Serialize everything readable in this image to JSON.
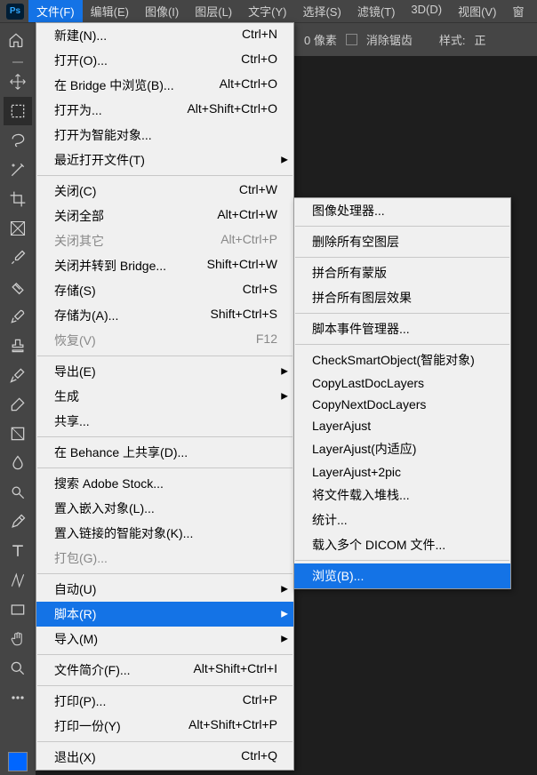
{
  "menubar": [
    "文件(F)",
    "编辑(E)",
    "图像(I)",
    "图层(L)",
    "文字(Y)",
    "选择(S)",
    "滤镜(T)",
    "3D(D)",
    "视图(V)",
    "窗"
  ],
  "psLabel": "Ps",
  "options": {
    "pixelValue": "0",
    "pixelUnit": "像素",
    "antialias": "消除锯齿",
    "style": "样式:",
    "styleVal": "正"
  },
  "file": [
    {
      "type": "item",
      "label": "新建(N)...",
      "short": "Ctrl+N"
    },
    {
      "type": "item",
      "label": "打开(O)...",
      "short": "Ctrl+O"
    },
    {
      "type": "item",
      "label": "在 Bridge 中浏览(B)...",
      "short": "Alt+Ctrl+O"
    },
    {
      "type": "item",
      "label": "打开为...",
      "short": "Alt+Shift+Ctrl+O"
    },
    {
      "type": "item",
      "label": "打开为智能对象..."
    },
    {
      "type": "item",
      "label": "最近打开文件(T)",
      "sub": true
    },
    {
      "type": "sep"
    },
    {
      "type": "item",
      "label": "关闭(C)",
      "short": "Ctrl+W"
    },
    {
      "type": "item",
      "label": "关闭全部",
      "short": "Alt+Ctrl+W"
    },
    {
      "type": "item",
      "label": "关闭其它",
      "short": "Alt+Ctrl+P",
      "disabled": true
    },
    {
      "type": "item",
      "label": "关闭并转到 Bridge...",
      "short": "Shift+Ctrl+W"
    },
    {
      "type": "item",
      "label": "存储(S)",
      "short": "Ctrl+S"
    },
    {
      "type": "item",
      "label": "存储为(A)...",
      "short": "Shift+Ctrl+S"
    },
    {
      "type": "item",
      "label": "恢复(V)",
      "short": "F12",
      "disabled": true
    },
    {
      "type": "sep"
    },
    {
      "type": "item",
      "label": "导出(E)",
      "sub": true
    },
    {
      "type": "item",
      "label": "生成",
      "sub": true
    },
    {
      "type": "item",
      "label": "共享..."
    },
    {
      "type": "sep"
    },
    {
      "type": "item",
      "label": "在 Behance 上共享(D)..."
    },
    {
      "type": "sep"
    },
    {
      "type": "item",
      "label": "搜索 Adobe Stock..."
    },
    {
      "type": "item",
      "label": "置入嵌入对象(L)..."
    },
    {
      "type": "item",
      "label": "置入链接的智能对象(K)..."
    },
    {
      "type": "item",
      "label": "打包(G)...",
      "disabled": true
    },
    {
      "type": "sep"
    },
    {
      "type": "item",
      "label": "自动(U)",
      "sub": true
    },
    {
      "type": "item",
      "label": "脚本(R)",
      "sub": true,
      "hl": true
    },
    {
      "type": "item",
      "label": "导入(M)",
      "sub": true
    },
    {
      "type": "sep"
    },
    {
      "type": "item",
      "label": "文件简介(F)...",
      "short": "Alt+Shift+Ctrl+I"
    },
    {
      "type": "sep"
    },
    {
      "type": "item",
      "label": "打印(P)...",
      "short": "Ctrl+P"
    },
    {
      "type": "item",
      "label": "打印一份(Y)",
      "short": "Alt+Shift+Ctrl+P"
    },
    {
      "type": "sep"
    },
    {
      "type": "item",
      "label": "退出(X)",
      "short": "Ctrl+Q"
    }
  ],
  "scripts": [
    {
      "type": "item",
      "label": "图像处理器..."
    },
    {
      "type": "sep"
    },
    {
      "type": "item",
      "label": "删除所有空图层"
    },
    {
      "type": "sep"
    },
    {
      "type": "item",
      "label": "拼合所有蒙版"
    },
    {
      "type": "item",
      "label": "拼合所有图层效果"
    },
    {
      "type": "sep"
    },
    {
      "type": "item",
      "label": "脚本事件管理器..."
    },
    {
      "type": "sep"
    },
    {
      "type": "item",
      "label": "CheckSmartObject(智能对象)"
    },
    {
      "type": "item",
      "label": "CopyLastDocLayers"
    },
    {
      "type": "item",
      "label": "CopyNextDocLayers"
    },
    {
      "type": "item",
      "label": "LayerAjust"
    },
    {
      "type": "item",
      "label": "LayerAjust(内适应)"
    },
    {
      "type": "item",
      "label": "LayerAjust+2pic"
    },
    {
      "type": "item",
      "label": "将文件载入堆栈..."
    },
    {
      "type": "item",
      "label": "统计..."
    },
    {
      "type": "item",
      "label": "载入多个 DICOM 文件..."
    },
    {
      "type": "sep"
    },
    {
      "type": "item",
      "label": "浏览(B)...",
      "hl": true
    }
  ],
  "tools": [
    "move",
    "marquee",
    "lasso",
    "wand",
    "crop",
    "frame",
    "eyedrop",
    "healing",
    "brush",
    "stamp",
    "history",
    "eraser",
    "gradient",
    "blur",
    "dodge",
    "pen",
    "type",
    "path",
    "rect",
    "hand",
    "zoom",
    "more"
  ]
}
